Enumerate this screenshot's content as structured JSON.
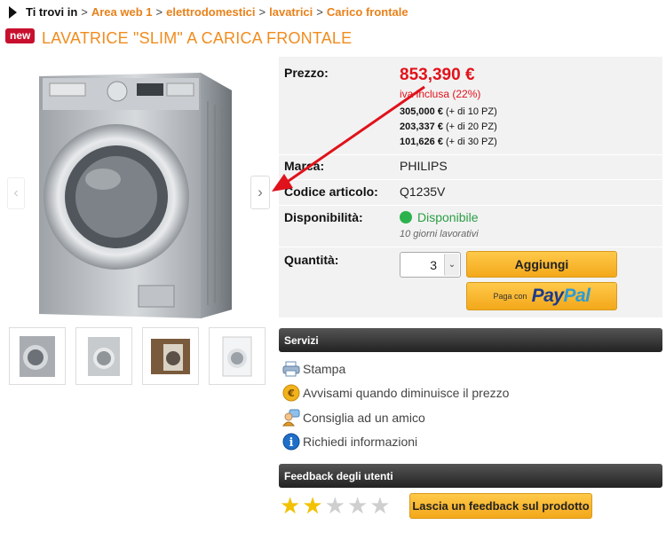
{
  "breadcrumb": {
    "lead": "Ti trovi in",
    "links": [
      "Area web 1",
      "elettrodomestici",
      "lavatrici",
      "Carico frontale"
    ]
  },
  "badge": "new",
  "product_title": "LAVATRICE \"SLIM\" A CARICA FRONTALE",
  "gallery": {
    "prev_icon": "chevron-left-icon",
    "next_icon": "chevron-right-icon",
    "thumbnail_count": 4
  },
  "info": {
    "price_label": "Prezzo:",
    "price": "853,390 €",
    "vat": "iva inclusa (22%)",
    "tiers": [
      {
        "price": "305,000 €",
        "qty": "(+ di 10 PZ)"
      },
      {
        "price": "203,337 €",
        "qty": "(+ di 20 PZ)"
      },
      {
        "price": "101,626 €",
        "qty": "(+ di 30 PZ)"
      }
    ],
    "brand_label": "Marca:",
    "brand": "PHILIPS",
    "code_label": "Codice articolo:",
    "code": "Q1235V",
    "availability_label": "Disponibilità:",
    "availability": "Disponibile",
    "availability_note": "10 giorni lavorativi",
    "qty_label": "Quantità:",
    "qty_value": "3",
    "add_button": "Aggiungi",
    "paypal_prefix": "Paga con",
    "paypal_pay": "Pay",
    "paypal_pal": "Pal"
  },
  "services": {
    "header": "Servizi",
    "items": [
      {
        "label": "Stampa",
        "icon": "printer-icon"
      },
      {
        "label": "Avvisami quando diminuisce il prezzo",
        "icon": "coin-icon"
      },
      {
        "label": "Consiglia ad un amico",
        "icon": "recommend-friend-icon"
      },
      {
        "label": "Richiedi informazioni",
        "icon": "info-icon"
      }
    ]
  },
  "feedback": {
    "header": "Feedback degli utenti",
    "rating": 2,
    "max_rating": 5,
    "button": "Lascia un feedback sul prodotto"
  },
  "colors": {
    "accent_orange": "#f08c1e",
    "price_red": "#e3121b",
    "available_green": "#2bb24c",
    "annotation_arrow": "#e0121b"
  }
}
